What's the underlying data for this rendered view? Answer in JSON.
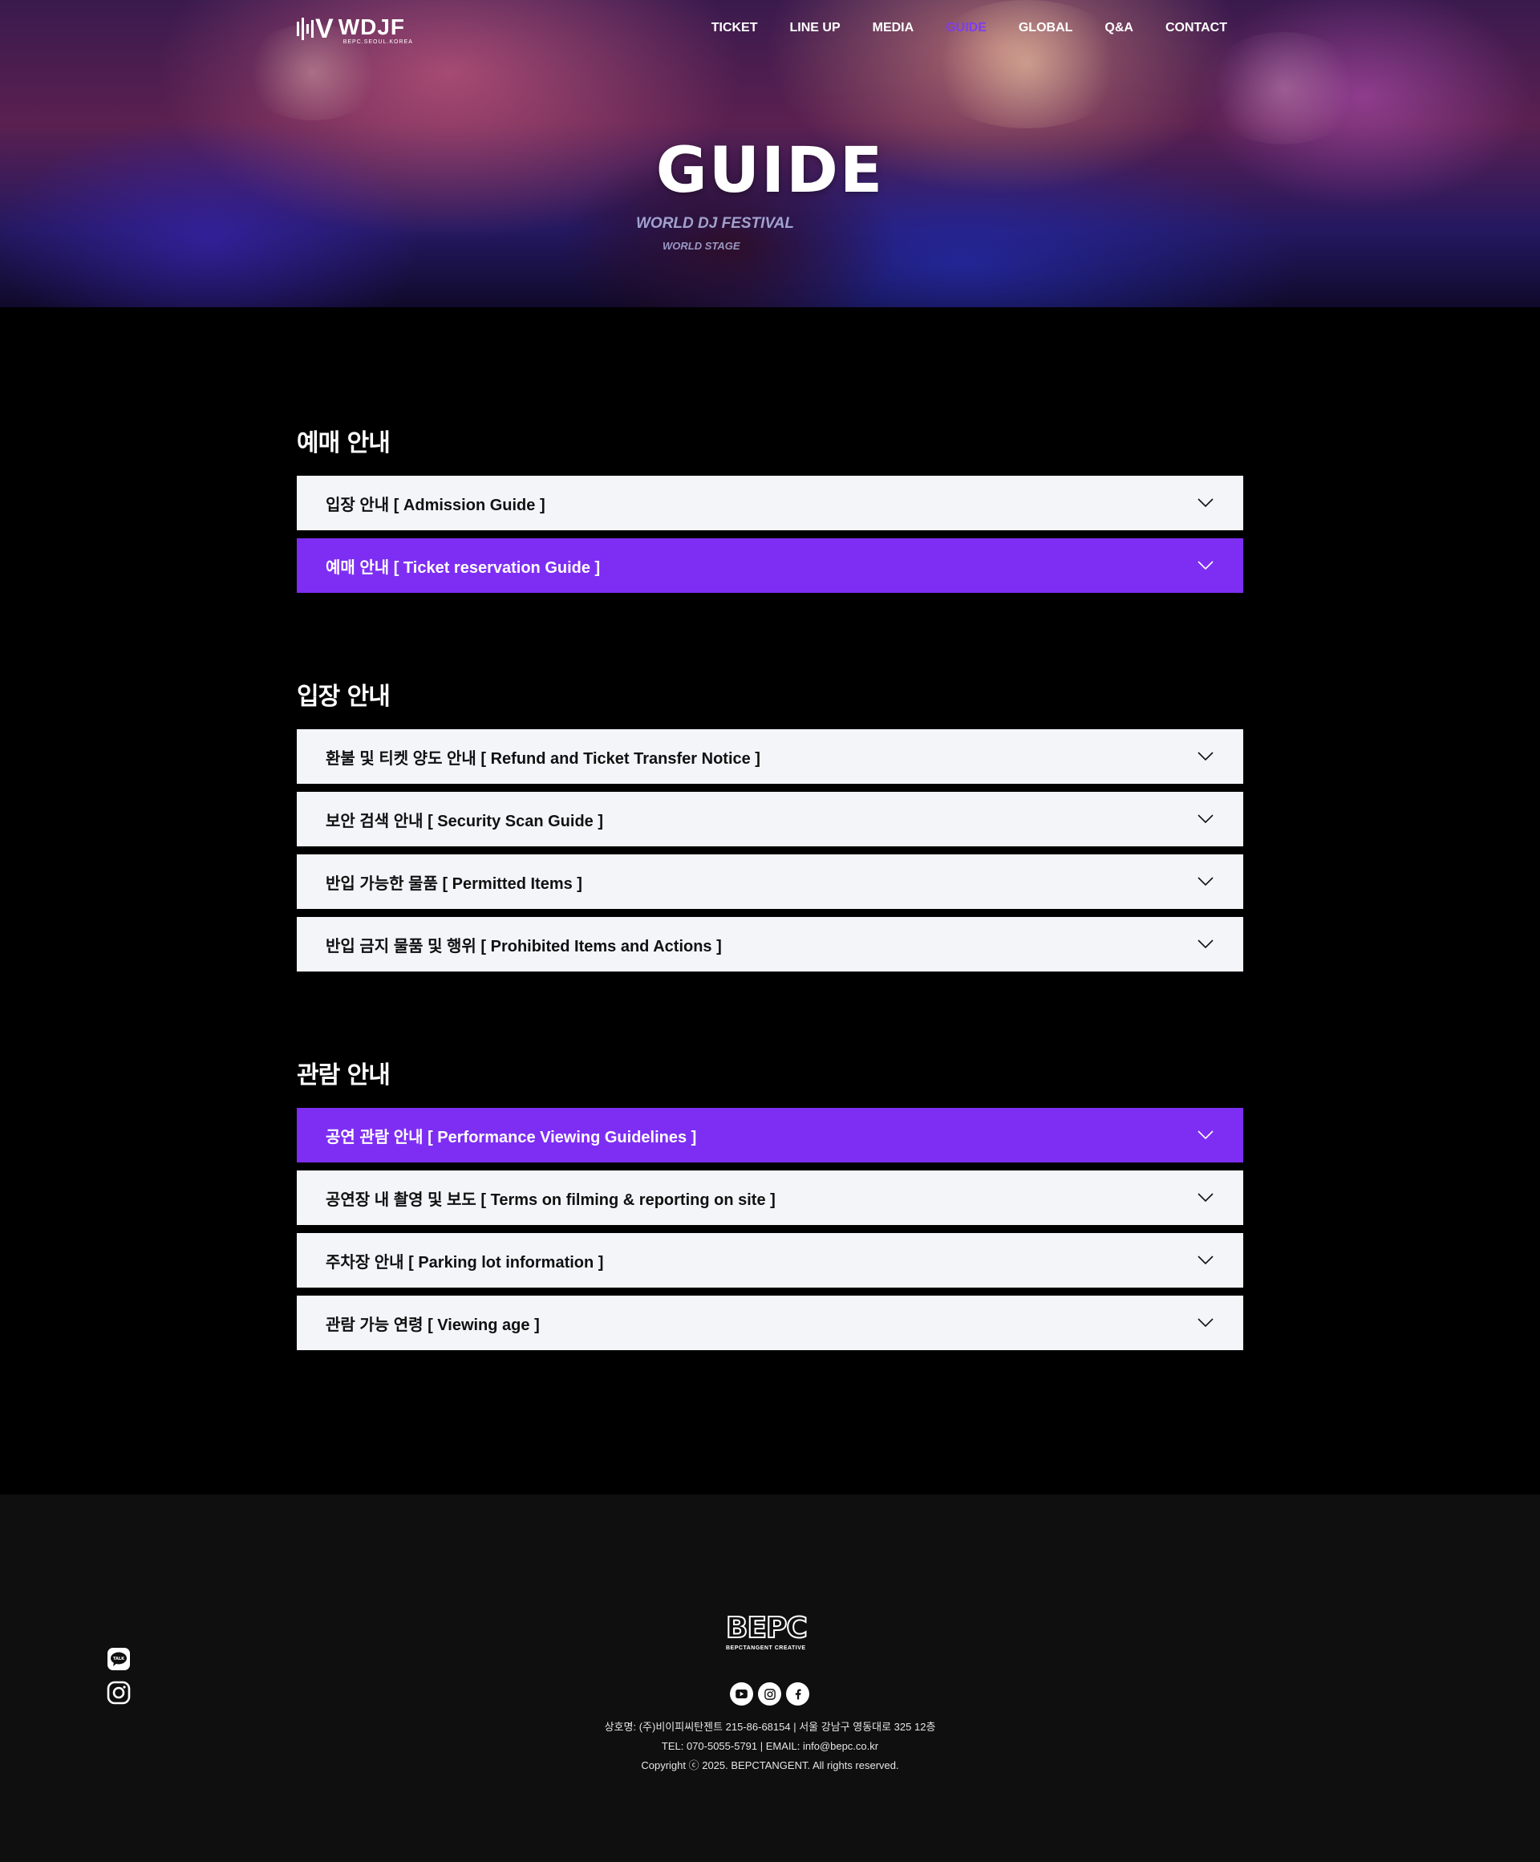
{
  "header": {
    "logo_name": "WDJF",
    "logo_tagline": "BEPC.SEOUL.KOREA",
    "nav": [
      "TICKET",
      "LINE UP",
      "MEDIA",
      "GUIDE",
      "GLOBAL",
      "Q&A",
      "CONTACT"
    ],
    "active_nav": "GUIDE"
  },
  "hero": {
    "title": "GUIDE",
    "subtitle_1": "WORLD DJ FESTIVAL",
    "subtitle_2": "WORLD STAGE"
  },
  "sections": [
    {
      "title": "예매 안내",
      "items": [
        {
          "label": "입장 안내 [ Admission Guide ]",
          "active": false
        },
        {
          "label": "예매 안내 [ Ticket reservation Guide ]",
          "active": true
        }
      ]
    },
    {
      "title": "입장 안내",
      "items": [
        {
          "label": "환불 및 티켓 양도 안내 [ Refund and Ticket Transfer Notice ]",
          "active": false
        },
        {
          "label": "보안 검색 안내 [ Security Scan Guide ]",
          "active": false
        },
        {
          "label": "반입 가능한 물품 [ Permitted Items ]",
          "active": false
        },
        {
          "label": "반입 금지 물품 및 행위 [ Prohibited Items and Actions ]",
          "active": false
        }
      ]
    },
    {
      "title": "관람 안내",
      "items": [
        {
          "label": "공연 관람 안내 [ Performance Viewing Guidelines ]",
          "active": true
        },
        {
          "label": "공연장 내 촬영 및 보도 [ Terms on filming & reporting on site ]",
          "active": false
        },
        {
          "label": "주차장 안내 [ Parking lot information ]",
          "active": false
        },
        {
          "label": "관람 가능 연령 [ Viewing age ]",
          "active": false
        }
      ]
    }
  ],
  "footer": {
    "brand_big": "BEPC",
    "brand_small": "BEPCTANGENT CREATIVE",
    "kakao_label": "TALK",
    "social_icons": [
      "youtube-icon",
      "instagram-icon",
      "facebook-icon"
    ],
    "line1": "상호명: (주)비이피씨탄젠트 215-86-68154   |  서울 강남구 영동대로 325 12층",
    "line2": "TEL: 070-5055-5791  | EMAIL: info@bepc.co.kr",
    "line3": "Copyright ⓒ 2025. BEPCTANGENT. All rights reserved."
  },
  "colors": {
    "accent": "#7e2ef3",
    "accordion_bg": "#f3f5f9",
    "page_bg": "#000000",
    "footer_bg": "#0f0f0f"
  }
}
